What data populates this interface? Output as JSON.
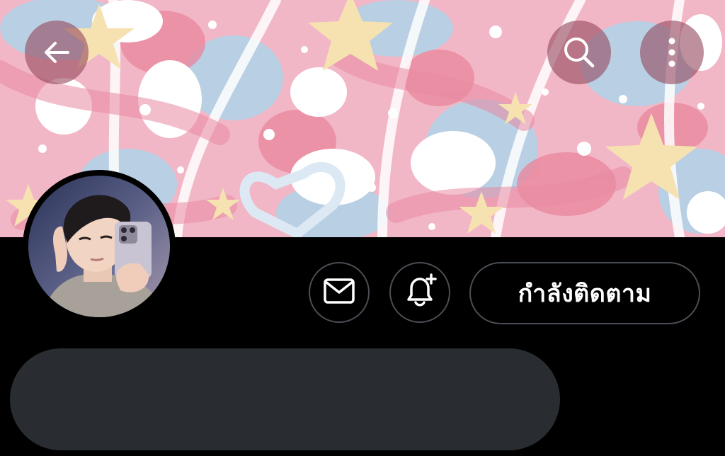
{
  "header": {
    "back_icon": "arrow-left-icon",
    "search_icon": "search-icon",
    "more_icon": "more-vertical-icon"
  },
  "profile": {
    "actions": {
      "message_icon": "envelope-icon",
      "notify_icon": "bell-plus-icon",
      "follow_label": "กำลังติดตาม"
    }
  },
  "colors": {
    "background": "#000000",
    "button_border": "#4a4f55",
    "name_placeholder": "#292c30",
    "banner_pink": "#f2b7c6",
    "banner_blue": "#bcd2e6",
    "banner_star": "#f6e2b0"
  }
}
